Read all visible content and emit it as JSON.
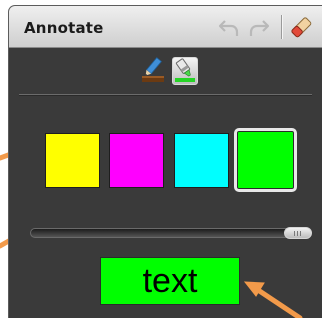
{
  "panel": {
    "title": "Annotate"
  },
  "toolbar": {
    "icons": [
      "undo-icon",
      "redo-icon",
      "eraser-icon"
    ]
  },
  "tools": [
    {
      "name": "pen-tool",
      "icon": "pen-icon",
      "selected": false
    },
    {
      "name": "highlighter-tool",
      "icon": "highlighter-icon",
      "selected": true
    }
  ],
  "swatches": [
    {
      "name": "yellow",
      "color": "#ffff00",
      "selected": false
    },
    {
      "name": "magenta",
      "color": "#ff00ff",
      "selected": false
    },
    {
      "name": "cyan",
      "color": "#00ffff",
      "selected": false
    },
    {
      "name": "green",
      "color": "#00ff00",
      "selected": true
    }
  ],
  "size_slider": {
    "level": 1.0
  },
  "preview": {
    "text": "text",
    "background": "#00ff00"
  },
  "colors": {
    "panel_bg": "#3a3a3a",
    "callout_arrow": "#f29a4a"
  }
}
